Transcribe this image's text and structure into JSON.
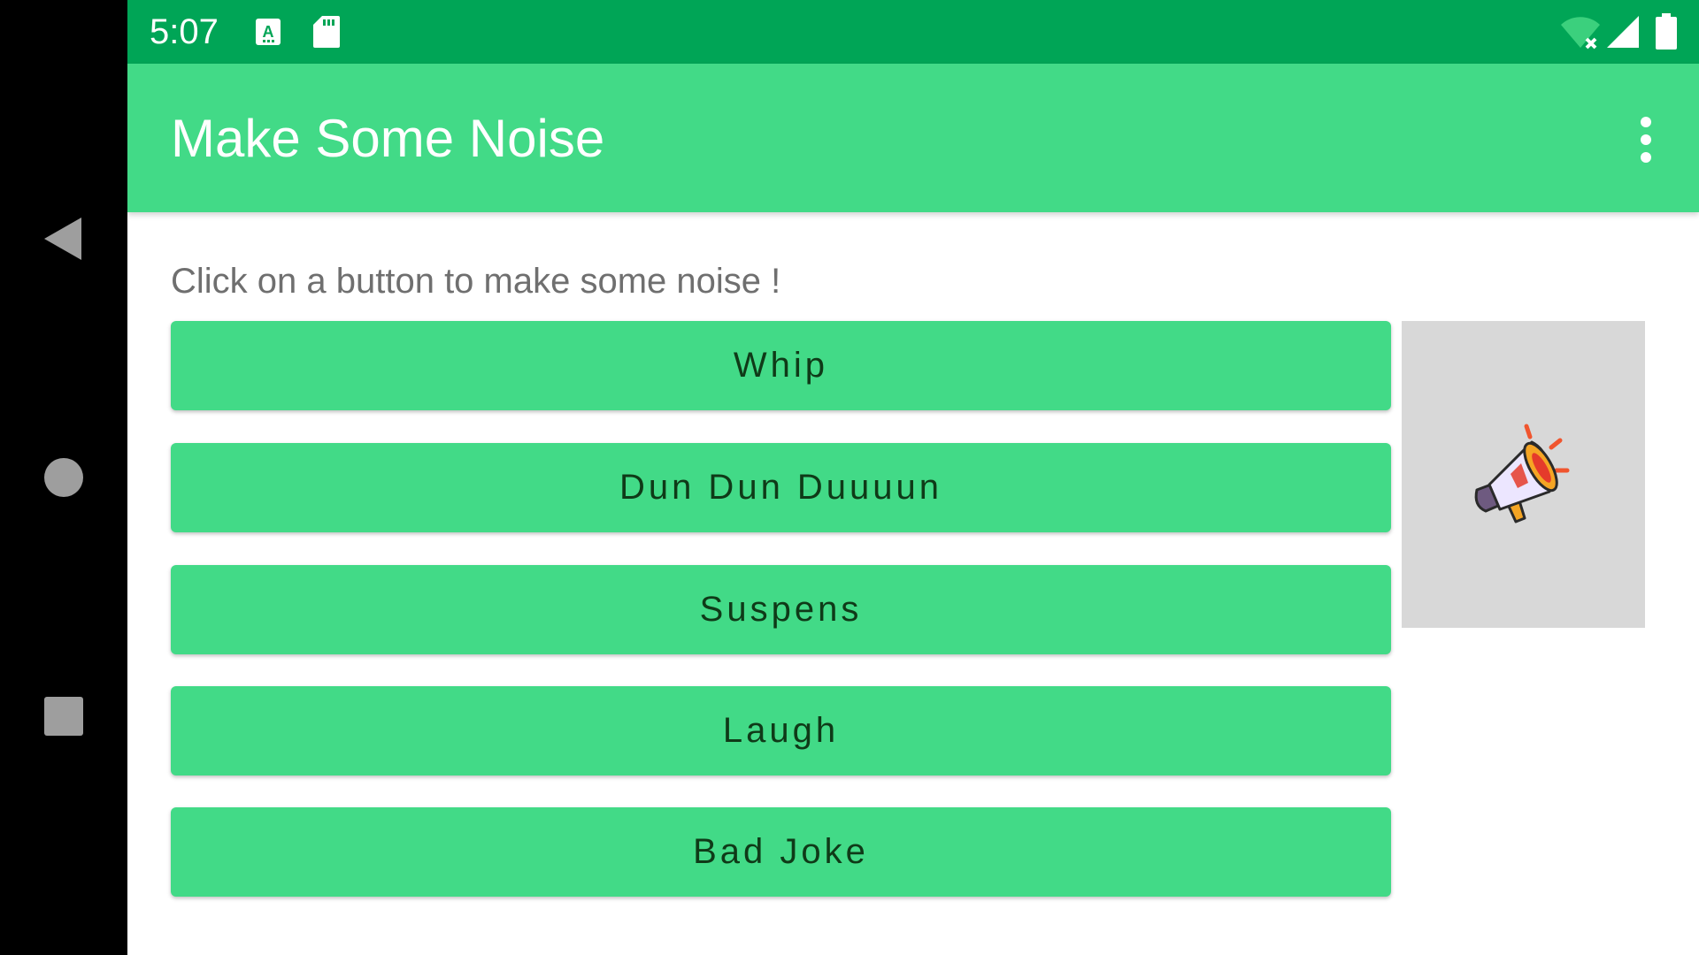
{
  "status_bar": {
    "time": "5:07",
    "icons": [
      "a-notification-icon",
      "sd-card-icon",
      "wifi-off-icon",
      "signal-icon",
      "battery-icon"
    ]
  },
  "navigation_bar": {
    "buttons": [
      "back-icon",
      "home-icon",
      "recents-icon"
    ]
  },
  "app_bar": {
    "title": "Make Some Noise",
    "overflow_icon": "more-vert-icon"
  },
  "main": {
    "instruction": "Click on a button to make some noise !",
    "buttons": [
      {
        "label": "Whip"
      },
      {
        "label": "Dun Dun Duuuun"
      },
      {
        "label": "Suspens"
      },
      {
        "label": "Laugh"
      },
      {
        "label": "Bad Joke"
      }
    ],
    "image": {
      "icon": "megaphone-icon"
    }
  },
  "colors": {
    "status_bar": "#00a556",
    "app_bar": "#42da87",
    "button": "#42da87",
    "button_text": "#0f3a18",
    "image_panel": "#d8d8d8",
    "instruction_text": "#6f6f6f"
  }
}
